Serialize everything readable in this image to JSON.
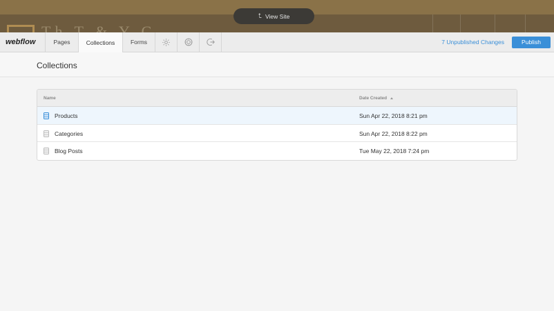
{
  "site_preview": {
    "title": "Th  T  &  Y  C"
  },
  "view_site": {
    "label": "View Site"
  },
  "toolbar": {
    "logo": "webflow",
    "tabs": [
      {
        "label": "Pages",
        "active": false
      },
      {
        "label": "Collections",
        "active": true
      },
      {
        "label": "Forms",
        "active": false
      }
    ],
    "icons": [
      "settings-icon",
      "integrations-icon",
      "exit-icon"
    ],
    "unpublished_changes": "7 Unpublished Changes",
    "publish_label": "Publish"
  },
  "page": {
    "title": "Collections"
  },
  "table": {
    "headers": {
      "name": "Name",
      "date": "Date Created"
    },
    "rows": [
      {
        "name": "Products",
        "date": "Sun Apr 22, 2018 8:21 pm",
        "active": true
      },
      {
        "name": "Categories",
        "date": "Sun Apr 22, 2018 8:22 pm",
        "active": false
      },
      {
        "name": "Blog Posts",
        "date": "Tue May 22, 2018 7:24 pm",
        "active": false
      }
    ]
  },
  "colors": {
    "accent": "#3a8fd8",
    "toolbar_bg": "#ececec",
    "page_bg": "#f5f5f5"
  }
}
